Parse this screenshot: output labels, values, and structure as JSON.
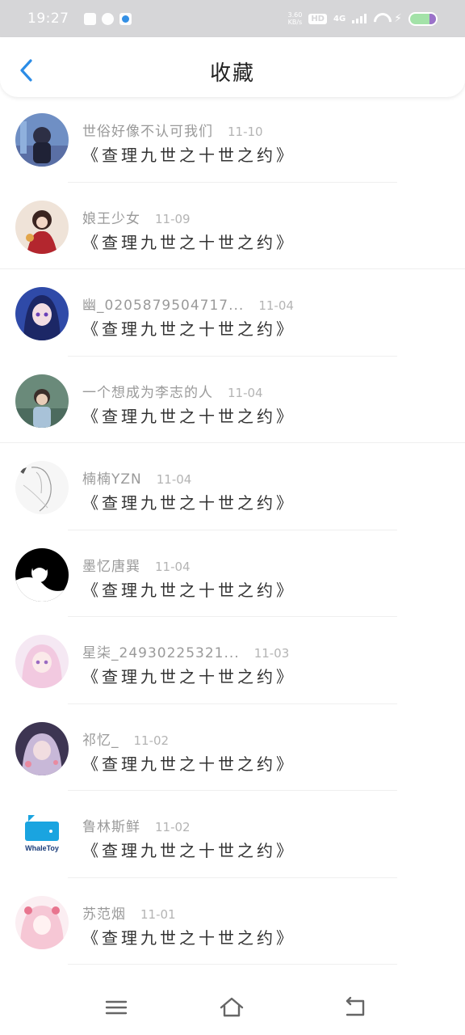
{
  "status_bar": {
    "time": "19:27",
    "net_speed_value": "3.60",
    "net_speed_unit": "KB/s",
    "hd": "HD",
    "network": "4G"
  },
  "header": {
    "title": "收藏"
  },
  "favorites": [
    {
      "user": "世俗好像不认可我们",
      "date": "11-10",
      "book": "《查理九世之十世之约》"
    },
    {
      "user": "娘王少女",
      "date": "11-09",
      "book": "《查理九世之十世之约》"
    },
    {
      "user": "幽_0205879504717...",
      "date": "11-04",
      "book": "《查理九世之十世之约》"
    },
    {
      "user": "一个想成为李志的人",
      "date": "11-04",
      "book": "《查理九世之十世之约》"
    },
    {
      "user": "楠楠YZN",
      "date": "11-04",
      "book": "《查理九世之十世之约》"
    },
    {
      "user": "墨忆唐巽",
      "date": "11-04",
      "book": "《查理九世之十世之约》"
    },
    {
      "user": "星柒_24930225321...",
      "date": "11-03",
      "book": "《查理九世之十世之约》"
    },
    {
      "user": "祁忆_",
      "date": "11-02",
      "book": "《查理九世之十世之约》"
    },
    {
      "user": "鲁林斯鲜",
      "date": "11-02",
      "book": "《查理九世之十世之约》"
    },
    {
      "user": "苏范烟",
      "date": "11-01",
      "book": "《查理九世之十世之约》"
    }
  ],
  "avatar_logo_text": "WhaleToy",
  "icons": {
    "back": "chevron-left-icon",
    "menu": "menu-icon",
    "home": "home-icon",
    "return": "return-icon"
  },
  "colors": {
    "accent": "#2b8ce6",
    "status_bar_bg": "#d6d6d8",
    "username": "#9a9a9a",
    "date": "#b4b4b4",
    "title": "#333333"
  }
}
